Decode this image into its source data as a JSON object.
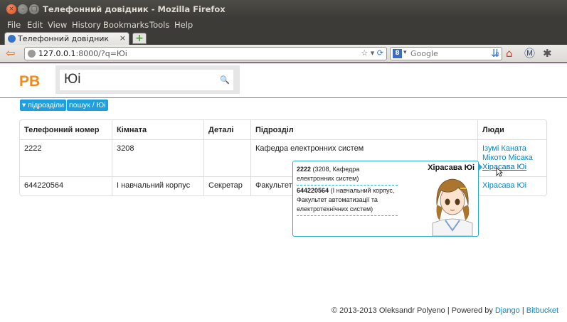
{
  "window": {
    "title": "Телефонний довідник - Mozilla Firefox"
  },
  "menu": [
    "File",
    "Edit",
    "View",
    "History",
    "Bookmarks",
    "Tools",
    "Help"
  ],
  "tab": {
    "label": "Телефонний довідник",
    "close": "×",
    "new": "+"
  },
  "nav": {
    "url_host": "127.0.0.1",
    "url_rest": ":8000/?q=Юі",
    "search_placeholder": "Google",
    "search_engine": "8"
  },
  "page": {
    "logo": "PB",
    "query": "Юі",
    "pills": {
      "departments": "▾ підрозділи",
      "search": "пошук / Юі"
    },
    "table": {
      "headers": [
        "Телефонний номер",
        "Кімната",
        "Деталі",
        "Підрозділ",
        "Люди"
      ],
      "rows": [
        {
          "phone": "2222",
          "room": "3208",
          "details": "",
          "department": "Кафедра електронних систем",
          "people": [
            "Ізумі Каната",
            "Мікото Місака",
            "Хірасава Юі"
          ]
        },
        {
          "phone": "644220564",
          "room": "I навчальний корпус",
          "details": "Секретар",
          "department": "Факультет автоматизації та електротехнічних систем",
          "people": [
            "Хірасава Юі"
          ]
        }
      ]
    },
    "popover": {
      "name": "Хірасава Юі",
      "entries": [
        {
          "number": "2222",
          "detail": "(3208, Кафедра електронних систем)"
        },
        {
          "number": "644220564",
          "detail": "(I навчальний корпус, Факультет автоматизації та електротехнічних систем)"
        }
      ]
    },
    "footer": {
      "copyright": "© 2013-2013 Oleksandr Polyeno | Powered by",
      "django": "Django",
      "sep": "|",
      "bitbucket": "Bitbucket"
    }
  },
  "colors": {
    "accent": "#1e9fe0",
    "logo": "#f08a1c",
    "link": "#0a88c4"
  }
}
